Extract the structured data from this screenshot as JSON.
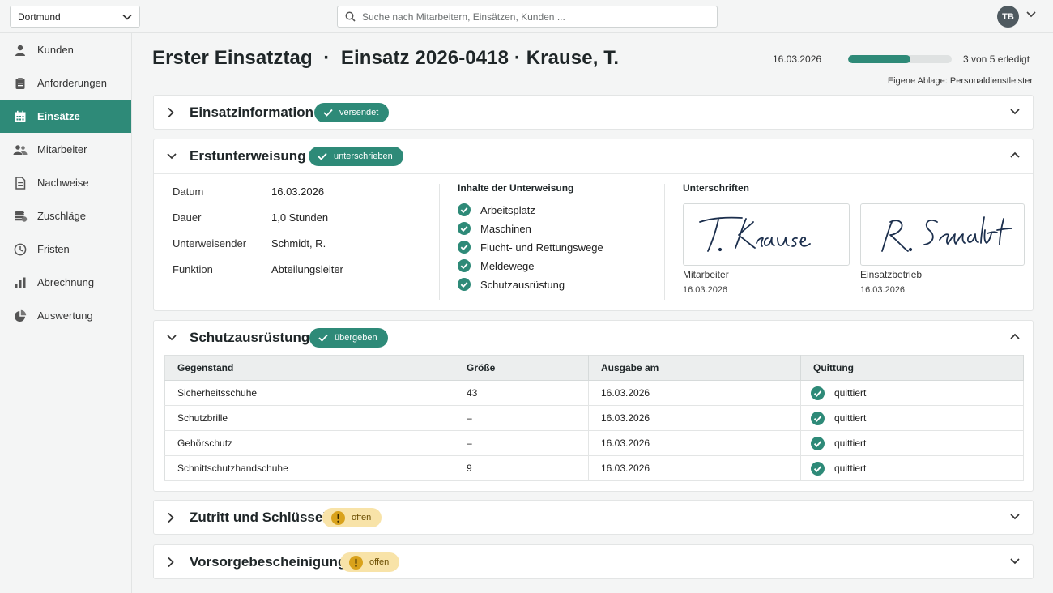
{
  "topbar": {
    "location": "Dortmund",
    "search_placeholder": "Suche nach Mitarbeitern, Einsätzen, Kunden ...",
    "avatar_initials": "TB"
  },
  "sidebar": {
    "items": [
      {
        "label": "Kunden",
        "icon": "person-icon",
        "active": false
      },
      {
        "label": "Anforderungen",
        "icon": "clipboard-icon",
        "active": false
      },
      {
        "label": "Einsätze",
        "icon": "calendar-icon",
        "active": true
      },
      {
        "label": "Mitarbeiter",
        "icon": "people-icon",
        "active": false
      },
      {
        "label": "Nachweise",
        "icon": "document-icon",
        "active": false
      },
      {
        "label": "Zuschläge",
        "icon": "coins-icon",
        "active": false
      },
      {
        "label": "Fristen",
        "icon": "clock-icon",
        "active": false
      },
      {
        "label": "Abrechnung",
        "icon": "bar-chart-icon",
        "active": false
      },
      {
        "label": "Auswertung",
        "icon": "pie-chart-icon",
        "active": false
      }
    ]
  },
  "header": {
    "title": "Erster Einsatztag  ·  Einsatz 2026-0418 · Krause, T.",
    "date": "16.03.2026",
    "progress_done": 3,
    "progress_total": 5,
    "progress_text": "3 von 5 erledigt",
    "ablage": "Eigene Ablage: Personaldienstleister"
  },
  "colors": {
    "accent": "#2e8a78",
    "warning_bg": "#f8e3a8",
    "warning_icon": "#d9a21b"
  },
  "sections": {
    "einsatzinformation": {
      "title": "Einsatzinformation",
      "badge": "versendet"
    },
    "erstunterweisung": {
      "title": "Erstunterweisung",
      "badge": "unterschrieben",
      "details": [
        {
          "label": "Datum",
          "value": "16.03.2026"
        },
        {
          "label": "Dauer",
          "value": "1,0 Stunden"
        },
        {
          "label": "Unterweisender",
          "value": "Schmidt, R."
        },
        {
          "label": "Funktion",
          "value": "Abteilungsleiter"
        }
      ],
      "inhalte_title": "Inhalte der Unterweisung",
      "inhalte": [
        "Arbeitsplatz",
        "Maschinen",
        "Flucht- und Rettungswege",
        "Meldewege",
        "Schutzausrüstung"
      ],
      "unterschriften_title": "Unterschriften",
      "signatures": [
        {
          "name": "T. Krause",
          "role": "Mitarbeiter",
          "date": "16.03.2026"
        },
        {
          "name": "R. Schmidt",
          "role": "Einsatzbetrieb",
          "date": "16.03.2026"
        }
      ]
    },
    "schutzausruestung": {
      "title": "Schutzausrüstung",
      "badge": "übergeben",
      "columns": [
        "Gegenstand",
        "Größe",
        "Ausgabe am",
        "Quittung"
      ],
      "rows": [
        {
          "item": "Sicherheitsschuhe",
          "size": "43",
          "date": "16.03.2026",
          "status": "quittiert"
        },
        {
          "item": "Schutzbrille",
          "size": "–",
          "date": "16.03.2026",
          "status": "quittiert"
        },
        {
          "item": "Gehörschutz",
          "size": "–",
          "date": "16.03.2026",
          "status": "quittiert"
        },
        {
          "item": "Schnittschutzhandschuhe",
          "size": "9",
          "date": "16.03.2026",
          "status": "quittiert"
        }
      ]
    },
    "zutritt": {
      "title": "Zutritt und Schlüssel",
      "badge": "offen"
    },
    "vorsorge": {
      "title": "Vorsorgebescheinigung",
      "badge": "offen"
    }
  }
}
